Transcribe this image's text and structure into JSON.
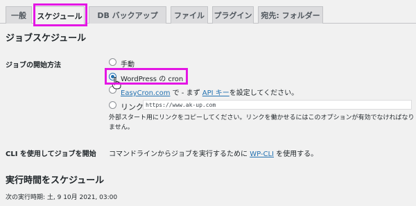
{
  "tabs": [
    {
      "label": "一般"
    },
    {
      "label": "スケジュール"
    },
    {
      "label": "DB バックアップ"
    },
    {
      "label": "ファイル"
    },
    {
      "label": "プラグイン"
    },
    {
      "label": "宛先: フォルダー"
    }
  ],
  "job_schedule": {
    "title": "ジョブスケジュール",
    "start_method_label": "ジョブの開始方法",
    "options": {
      "manual": "手動",
      "wp_cron": "WordPress の cron",
      "easycron_link": "EasyCron.com",
      "easycron_mid": " で - まず ",
      "api_key_link": "API キー",
      "easycron_end": "を設定してください。",
      "link_label": "リンク",
      "link_url": "https://www.ak-up.com",
      "link_help_1": "外部スタート用にリンクをコピーしてください。リンクを働かせるにはこのオプションが有効でなければなり",
      "link_help_2": "ません。"
    },
    "cli_label": "CLI を使用してジョブを開始",
    "cli_text_before": "コマンドラインからジョブを実行するために ",
    "cli_link": "WP-CLI",
    "cli_text_after": " を使用する。"
  },
  "run_schedule": {
    "title": "実行時間をスケジュール",
    "next_run": "次の実行時期: 土, 9 10月 2021, 03:00"
  },
  "colors": {
    "highlight": "#e416e4",
    "link": "#2271b1"
  }
}
